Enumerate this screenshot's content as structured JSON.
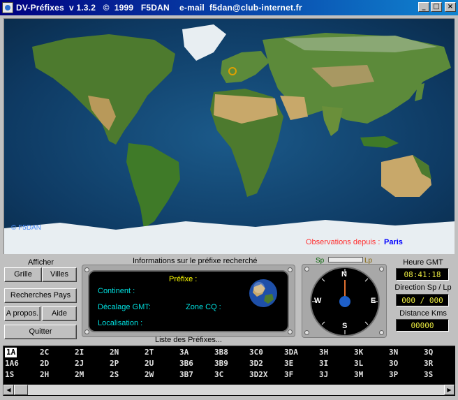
{
  "window": {
    "title": "DV-Préfixes  v 1.3.2   ©  1999   F5DAN    e-mail  f5dan@club-internet.fr",
    "minimize": "_",
    "maximize": "□",
    "close": "×"
  },
  "map": {
    "copyright": "© F5DAN",
    "observation_label": "Observations depuis :",
    "observation_city": "Paris",
    "colors": {
      "ocean": "#0e3a63",
      "land": "#4d7a2e",
      "desert": "#c8a86a",
      "ice": "#e8eef2",
      "marker": "#e0a000"
    }
  },
  "afficher": {
    "title": "Afficher",
    "grille": "Grille",
    "villes": "Villes",
    "recherches_pays": "Recherches Pays",
    "apropos": "A propos.",
    "aide": "Aide",
    "quitter": "Quitter"
  },
  "info": {
    "title": "Informations sur le préfixe recherché",
    "prefixe": "Préfixe :",
    "continent": "Continent :",
    "decalage": "Décalage GMT:",
    "zone_cq": "Zone CQ :",
    "localisation": "Localisation :"
  },
  "compass": {
    "sp": "Sp",
    "lp": "Lp",
    "n": "N",
    "s": "S",
    "e": "E",
    "w": "W"
  },
  "right": {
    "heure_label": "Heure GMT",
    "heure_value": "08:41:18",
    "direction_label": "Direction Sp / Lp",
    "direction_value": "000 / 000",
    "distance_label": "Distance Kms",
    "distance_value": "00000"
  },
  "prefix_list": {
    "title": "Liste des Préfixes...",
    "selected": "1A",
    "columns": [
      [
        "1A",
        "1A6",
        "1S"
      ],
      [
        "2C",
        "2D",
        "2H"
      ],
      [
        "2I",
        "2J",
        "2M"
      ],
      [
        "2N",
        "2P",
        "2S"
      ],
      [
        "2T",
        "2U",
        "2W"
      ],
      [
        "3A",
        "3B6",
        "3B7"
      ],
      [
        "3B8",
        "3B9",
        "3C"
      ],
      [
        "3C0",
        "3D2",
        "3D2X"
      ],
      [
        "3DA",
        "3E",
        "3F"
      ],
      [
        "3H",
        "3I",
        "3J"
      ],
      [
        "3K",
        "3L",
        "3M"
      ],
      [
        "3N",
        "3O",
        "3P"
      ],
      [
        "3Q",
        "3R",
        "3S"
      ]
    ],
    "scroll_left": "◀",
    "scroll_right": "▶"
  }
}
